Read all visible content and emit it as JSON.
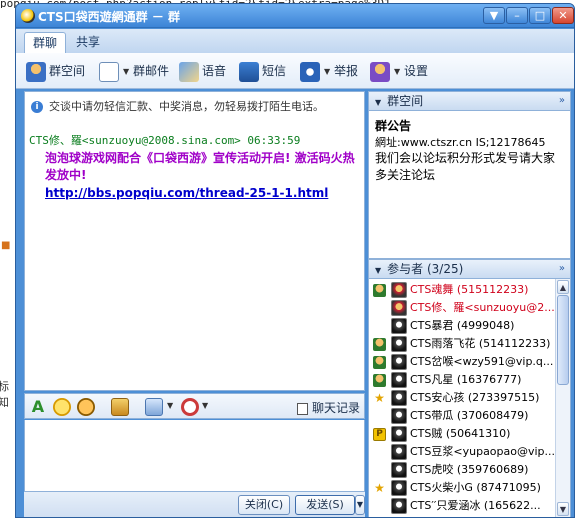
{
  "background": {
    "url_text": "popqiu.com/post.php?action-reply&fid=2&tid=2&extra=page%3D1",
    "left_fragment": "标知"
  },
  "window": {
    "title": "CTS口袋西遊網通群 － 群",
    "minimize": "–",
    "maximize": "□",
    "close": "✕"
  },
  "tabs": [
    {
      "label": "群聊"
    },
    {
      "label": "共享"
    }
  ],
  "toolbar": {
    "group_space": "群空间",
    "group_mail": "群邮件",
    "voice": "语音",
    "sms": "短信",
    "report": "举报",
    "settings": "设置"
  },
  "chat": {
    "notice": "交谈中请勿轻信汇款、中奖消息，勿轻易拨打陌生电话。",
    "message": {
      "header": "CTS修、羅<sunzuoyu@2008.sina.com> 06:33:59",
      "body": "泡泡球游戏网配合《口袋西游》宣传活动开启! 激活码火热发放中!",
      "link": "http://bbs.popqiu.com/thread-25-1-1.html"
    }
  },
  "format_bar": {
    "history": "聊天记录"
  },
  "send_bar": {
    "close": "关闭(C)",
    "send": "发送(S)"
  },
  "group_space_panel": {
    "header": "群空间",
    "bulletin_title": "群公告",
    "site_line": "網址:www.ctszr.cn   IS;12178645",
    "text": "我们会以论坛积分形式发号请大家多关注论坛"
  },
  "members_panel": {
    "header": "参与者 (3/25)",
    "members": [
      {
        "name": "CTS魂舞 (515112233)",
        "color": "#d0021b",
        "badge": "owner"
      },
      {
        "name": "CTS修、羅<sunzuoyu@2...",
        "color": "#d0021b",
        "badge": ""
      },
      {
        "name": "CTS暴君 (4999048)",
        "color": "#000000",
        "badge": ""
      },
      {
        "name": "CTS雨落飞花 (514112233)",
        "color": "#000000",
        "badge": "admin"
      },
      {
        "name": "CTS岔喉<wzy591@vip.q...",
        "color": "#000000",
        "badge": "admin"
      },
      {
        "name": "CTS凡星 (16376777)",
        "color": "#000000",
        "badge": "admin"
      },
      {
        "name": "CTS安心孩 (273397515)",
        "color": "#000000",
        "badge": "star"
      },
      {
        "name": "CTS带瓜 (370608479)",
        "color": "#000000",
        "badge": ""
      },
      {
        "name": "CTS贼 (50641310)",
        "color": "#000000",
        "badge": "p"
      },
      {
        "name": "CTS豆浆<yupaopao@vip....",
        "color": "#000000",
        "badge": ""
      },
      {
        "name": "CTS虎咬 (359760689)",
        "color": "#000000",
        "badge": ""
      },
      {
        "name": "CTS火柴小G (87471095)",
        "color": "#000000",
        "badge": "star"
      },
      {
        "name": "CTS′′只爱涵冰 (165622...",
        "color": "#000000",
        "badge": ""
      }
    ]
  },
  "colors": {
    "window_frame": "#4d8fd6",
    "owner_red": "#d0021b",
    "message_purple": "#a000c8",
    "message_header_green": "#0a7d1e",
    "link_blue": "#0000cc"
  }
}
